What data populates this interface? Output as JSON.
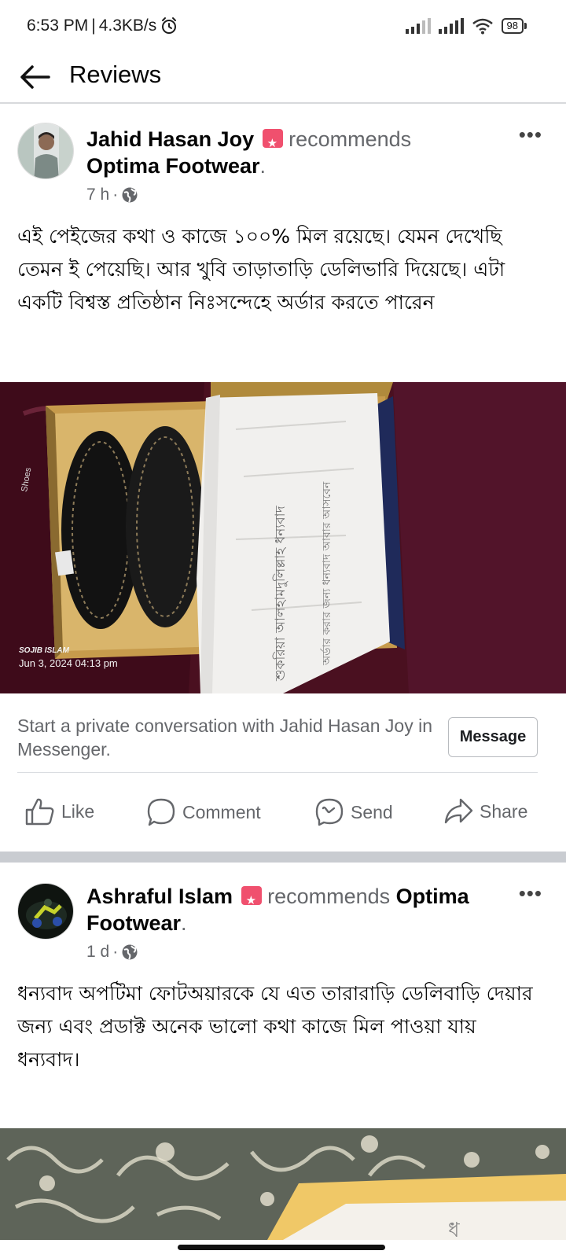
{
  "status_bar": {
    "time": "6:53 PM",
    "separator": "|",
    "speed": "4.3KB/s",
    "battery": "98"
  },
  "header": {
    "title": "Reviews"
  },
  "posts": [
    {
      "author": "Jahid Hasan Joy",
      "recommends": "recommends",
      "page": "Optima Footwear",
      "period": ".",
      "time": "7 h",
      "dot": "·",
      "text": "এই পেইজের কথা ও কাজে ১০০% মিল রয়েছে। যেমন দেখেছি তেমন ই পেয়েছি। আর খুবি তাড়াতাড়ি ডেলিভারি দিয়েছে। এটা একটি বিশ্বস্ত প্রতিষ্ঠান নিঃসন্দেহে অর্ডার করতে পারেন",
      "photo_watermark_name": "SOJIB ISLAM",
      "photo_watermark_date": "Jun 3, 2024 04:13 pm",
      "messenger_prompt": "Start a private conversation with Jahid Hasan Joy in Messenger.",
      "message_label": "Message"
    },
    {
      "author": "Ashraful Islam",
      "recommends": "recommends",
      "page": "Optima Footwear",
      "period": ".",
      "time": "1 d",
      "dot": "·",
      "text": "ধন্যবাদ অপটিমা ফোটঅয়ারকে যে এত তারারাড়ি ডেলিবাড়ি দেয়ার জন্য এবং প্রডাক্ট অনেক ভালো কথা কাজে মিল পাওয়া যায় ধন্যবাদ।"
    }
  ],
  "actions": {
    "like": "Like",
    "comment": "Comment",
    "send": "Send",
    "share": "Share"
  },
  "colors": {
    "text_primary": "#050505",
    "text_secondary": "#65676b",
    "badge": "#f0506e",
    "separator": "#c9ccd1"
  }
}
